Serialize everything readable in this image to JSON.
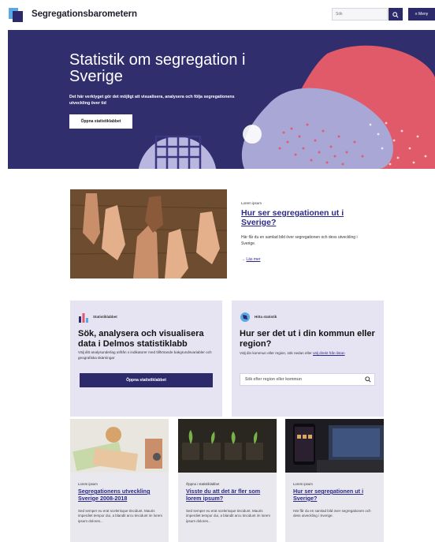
{
  "header": {
    "brand": "Segregationsbarometern",
    "search_placeholder": "Sök",
    "menu_label": "≡ Meny"
  },
  "hero": {
    "title": "Statistik om segregation i Sverige",
    "text": "Det här verktyget gör det möjligt att visualisera, analysera och följa segregationens utveckling över tid",
    "button": "Öppna statistiklabbet"
  },
  "feature": {
    "eyebrow": "Lorem ipsum",
    "title": "Hur ser segregationen ut i Sverige?",
    "text": "Här får du en samlad bild över segregationen och dess utveckling i Sverige.",
    "link_arrow": "→",
    "link": "Läs mer"
  },
  "card_lab": {
    "eyebrow": "Statistiklabbet",
    "title": "Sök, analysera och visualisera data i Delmos statistiklabb",
    "text": "Välj ditt analysunderlag utifrån x indikatorer med tillhörande bakgrundsvariabler och geografiska skärningar",
    "button": "Öppna statistiklabbet"
  },
  "card_region": {
    "eyebrow": "Hitta statistik",
    "title": "Hur ser det ut i din kommun eller region?",
    "text_prefix": "Välj din kommun eller region, sök nedan eller ",
    "text_link": "välj direkt från listan",
    "input_placeholder": "Sök efter region eller kommun"
  },
  "articles": [
    {
      "eyebrow": "Lorem ipsum",
      "title": "Segregationens utveckling Sverige 2008-2018",
      "text": "Sed semper eu erat scelerisque tincidunt. Mauris imperdiet tempor dui, a blandit arcu tincidunt im lorem ipsum dolores..."
    },
    {
      "eyebrow": "Öppna i statistiklabbet",
      "title": "Visste du att det är fler som lorem ipsum?",
      "text": "Sed semper eu erat scelerisque tincidunt. Mauris imperdiet tempor dui, a blandit arcu tincidunt im lorem ipsum dolores..."
    },
    {
      "eyebrow": "Lorem ipsum",
      "title": "Hur ser segregationen ut i Sverige?",
      "text": "Här får du en samlad bild över segregationen och dess utveckling i Sverige."
    }
  ],
  "colors": {
    "brand_navy": "#2c2a6b",
    "hero_bg": "#312e6e",
    "accent_coral": "#e05a6a",
    "link_blue": "#2e2a8a",
    "card_lavender": "#e6e4f2"
  }
}
